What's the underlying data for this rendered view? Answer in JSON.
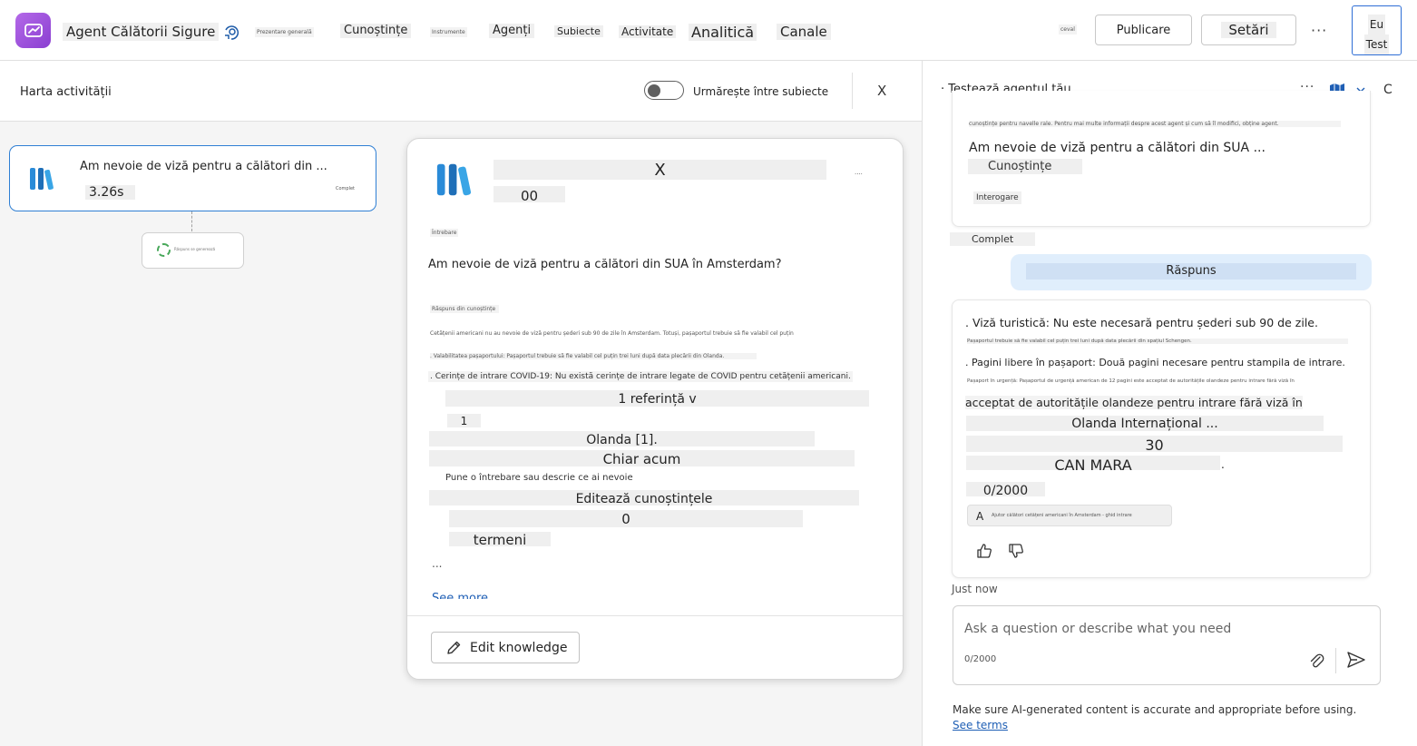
{
  "header": {
    "agent_name": "Agent Călătorii Sigure",
    "nav": {
      "overview": "Prezentare generală",
      "knowledge": "Cunoștințe",
      "tools": "Instrumente",
      "agents": "Agenți",
      "topics": "Subiecte",
      "activity": "Activitate",
      "analytics": "Analitică",
      "channels": "Canale"
    },
    "small_label": "ceval",
    "publish": "Publicare",
    "settings": "Setări",
    "more": "···",
    "test_line1": "Eu",
    "test_line2": "Test",
    "icons": {
      "logo": "plane-icon",
      "agent": "tag-icon"
    }
  },
  "activity_map": {
    "title": "Harta activității",
    "toggle_label": "Urmărește între subiecte",
    "toggle_on": false,
    "close": "X",
    "trigger": {
      "title": "Am nevoie de viză pentru a călători din ...",
      "time": "3.26s",
      "badge": "Complet"
    },
    "loading_text": "Răspuns se generează"
  },
  "detail": {
    "title": "X",
    "subtitle": "00",
    "more": "····",
    "section_label": "Întrebare",
    "question": "Am nevoie de viză pentru a călători din SUA în Amsterdam?",
    "answer_label": "Răspuns din cunoștințe",
    "tiny_line_1": "Cetățenii americani nu au nevoie de viză pentru șederi sub 90 de zile în Amsterdam. Totuși, pașaportul trebuie să fie valabil cel puțin",
    "tiny_line_2": ". Valabilitatea pașaportului: Pașaportul trebuie să fie valabil cel puțin trei luni după data plecării din Olanda.",
    "covid": ". Cerințe de intrare COVID-19: Nu există cerințe de intrare legate de COVID pentru cetățenii americani.",
    "references": "1 referință v",
    "ref_num": "1",
    "source": "Olanda [1].",
    "time": "Chiar acum",
    "prompt": "Pune o întrebare sau descrie ce ai nevoie",
    "edit_line": "Editează cunoștințele",
    "zero": "0",
    "terms": "termeni",
    "ellipsis": "...",
    "see_more": "See more",
    "edit_button": "Edit knowledge"
  },
  "test_panel": {
    "title": "· Testează agentul tău",
    "more": "···",
    "refresh": "C",
    "first_card": {
      "top_line": "cunoștințe pentru navelle rale. Pentru mai multe informații despre acest agent și cum să îl modifici, obține agent.",
      "question": "Am nevoie de viză pentru a călători din SUA ...",
      "chip1": "Cunoștințe",
      "chip2": "Interogare"
    },
    "status": "Complet",
    "response_label": "Răspuns",
    "answer": {
      "line1": ". Viză turistică: Nu este necesară pentru șederi sub 90 de zile.",
      "line2": "Pașaportul trebuie să fie valabil cel puțin trei luni după data plecării din spațiul Schengen.",
      "line3": ". Pagini libere în pașaport: Două pagini necesare pentru stampila de intrare.",
      "line4": "Pașaport în urgență: Pașaportul de urgență american de 12 pagini este acceptat de autoritățile olandeze pentru intrare fără viză în",
      "line5": "acceptat de autoritățile olandeze pentru intrare fără viză în",
      "line6": "Olanda Internațional ...",
      "line7": "30",
      "line8": "CAN MARA",
      "line8_suffix": ".",
      "counter": "0/2000",
      "ref_letter": "A",
      "ref_text": "Ajutor călători cetățeni americani în Amsterdam - ghid intrare"
    },
    "just_now": "Just now",
    "input_placeholder": "Ask a question or describe what you need",
    "input_counter": "0/2000",
    "disclaimer": "Make sure AI-generated content is accurate and appropriate before using.",
    "see_terms": "See terms"
  }
}
